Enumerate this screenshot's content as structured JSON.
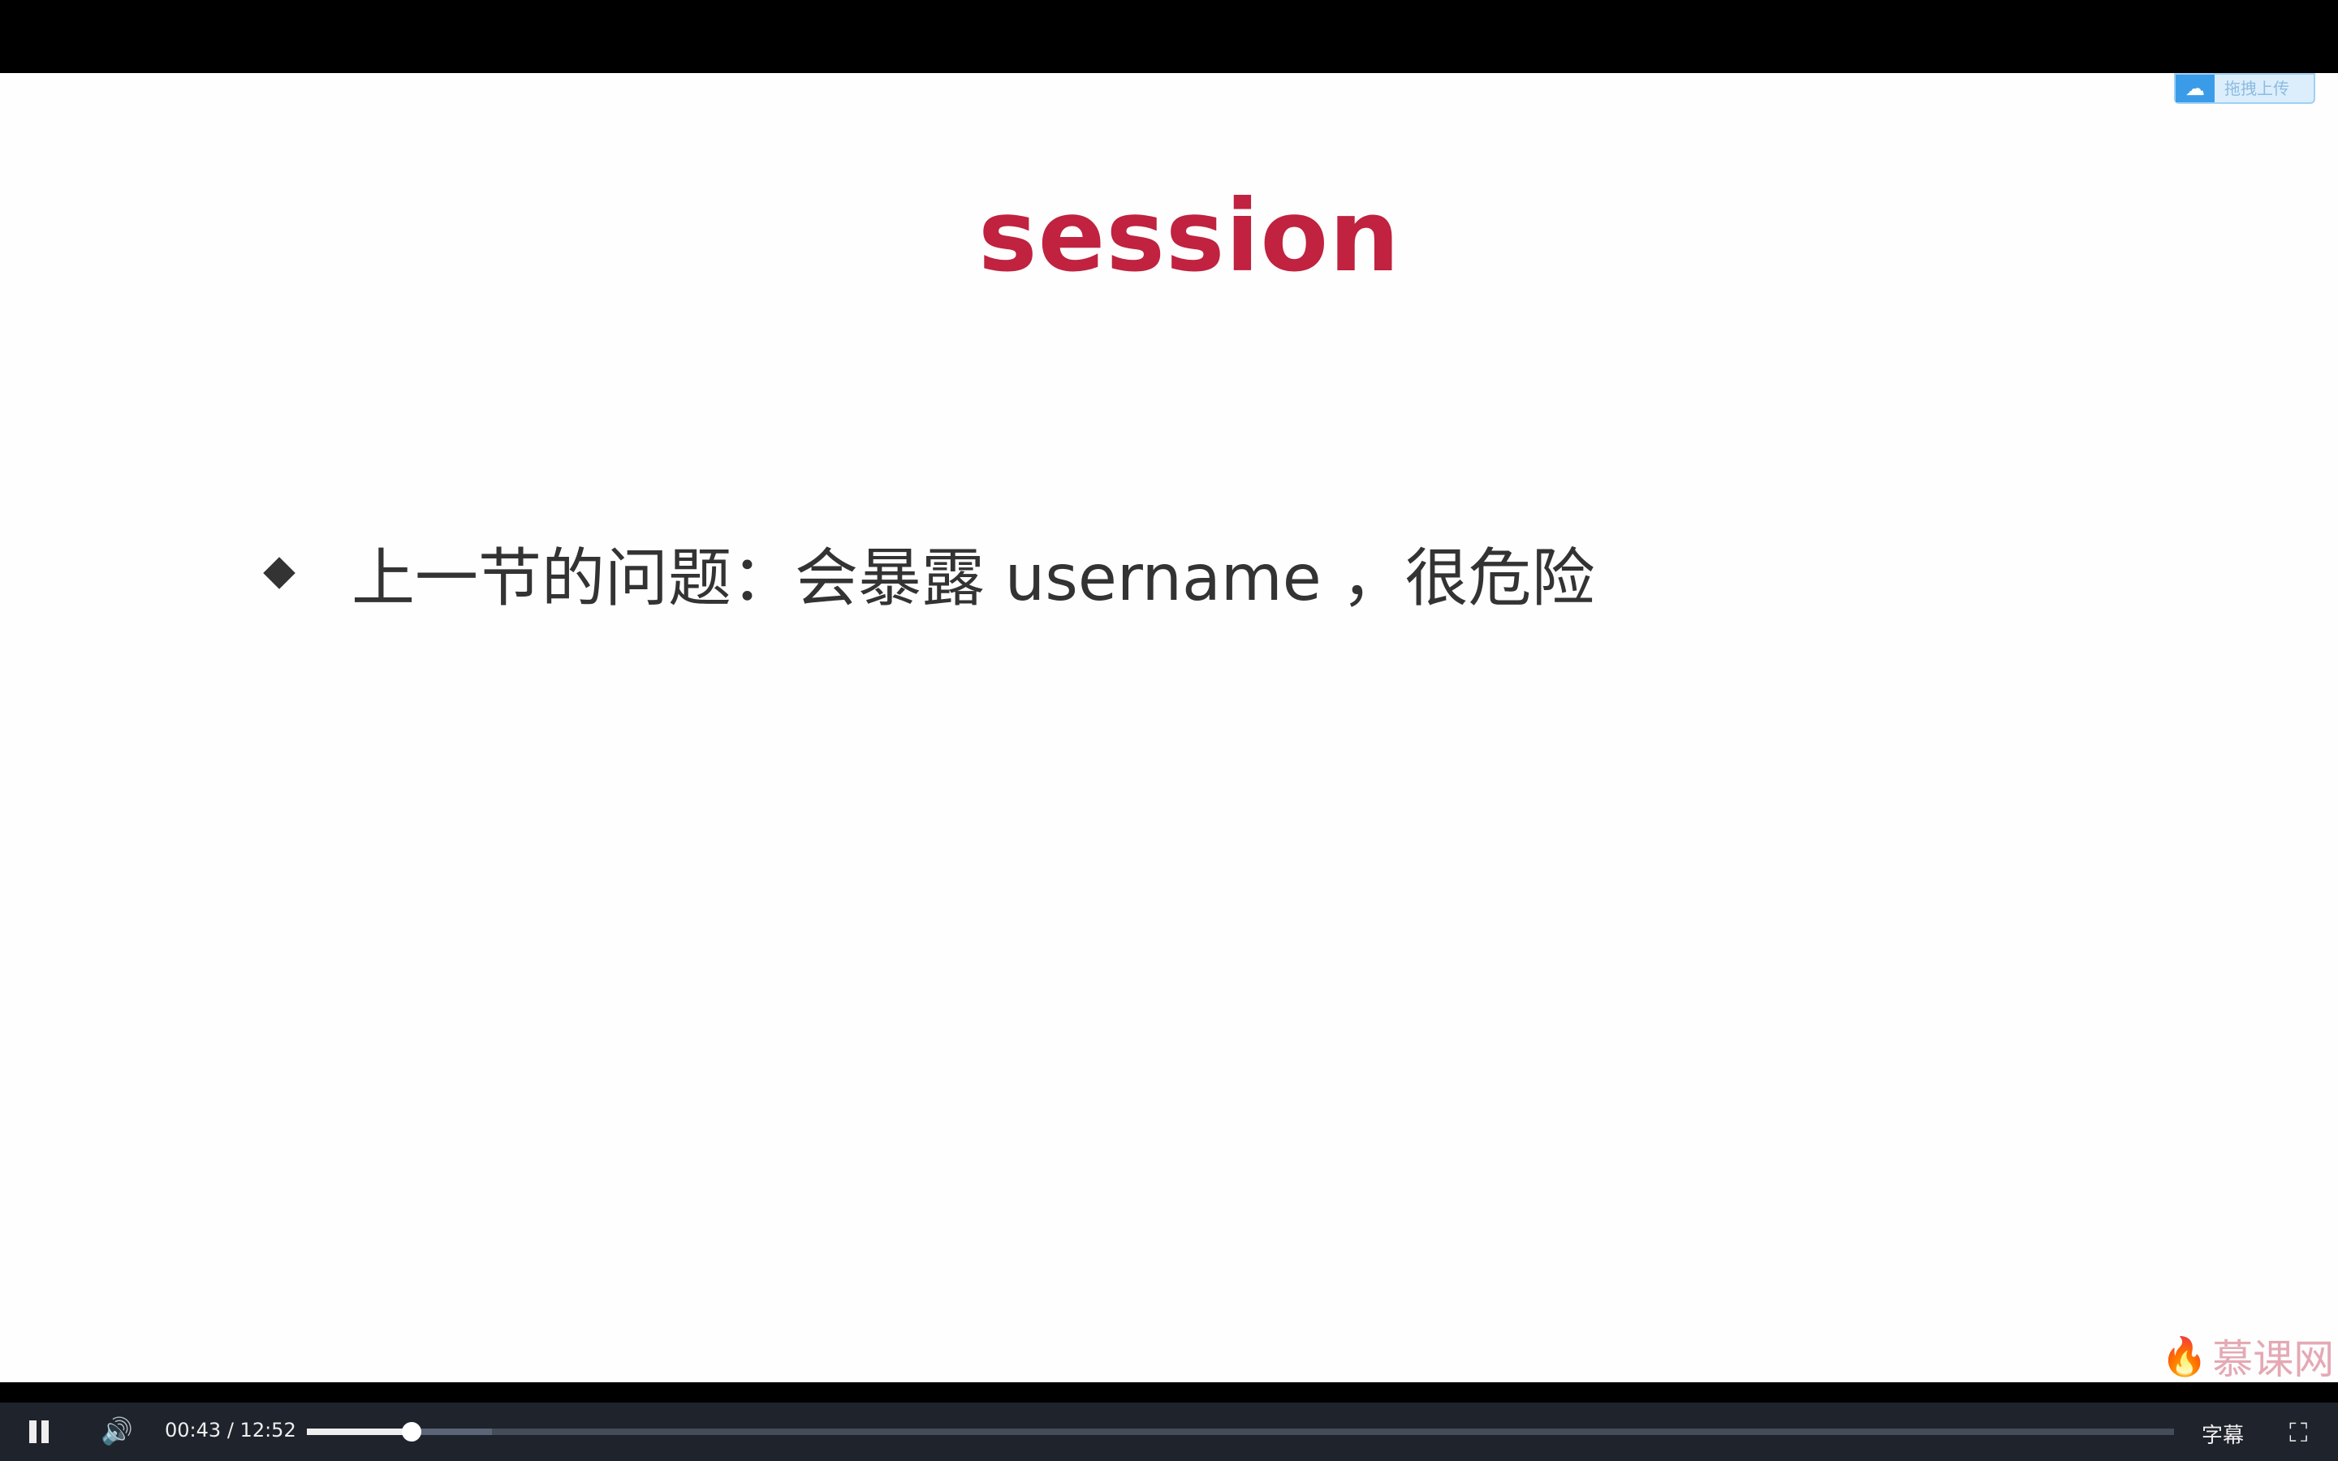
{
  "slide": {
    "title": "session",
    "bullet_text": "上一节的问题：会暴露 username ，很危险",
    "upload_badge": "拖拽上传",
    "watermark": "慕课网"
  },
  "player": {
    "current_time": "00:43",
    "separator": "/",
    "duration": "12:52",
    "progress_percent": 5.6,
    "buffered_percent": 9.9,
    "subtitle_label": "字幕",
    "accent": "#c0223f"
  }
}
